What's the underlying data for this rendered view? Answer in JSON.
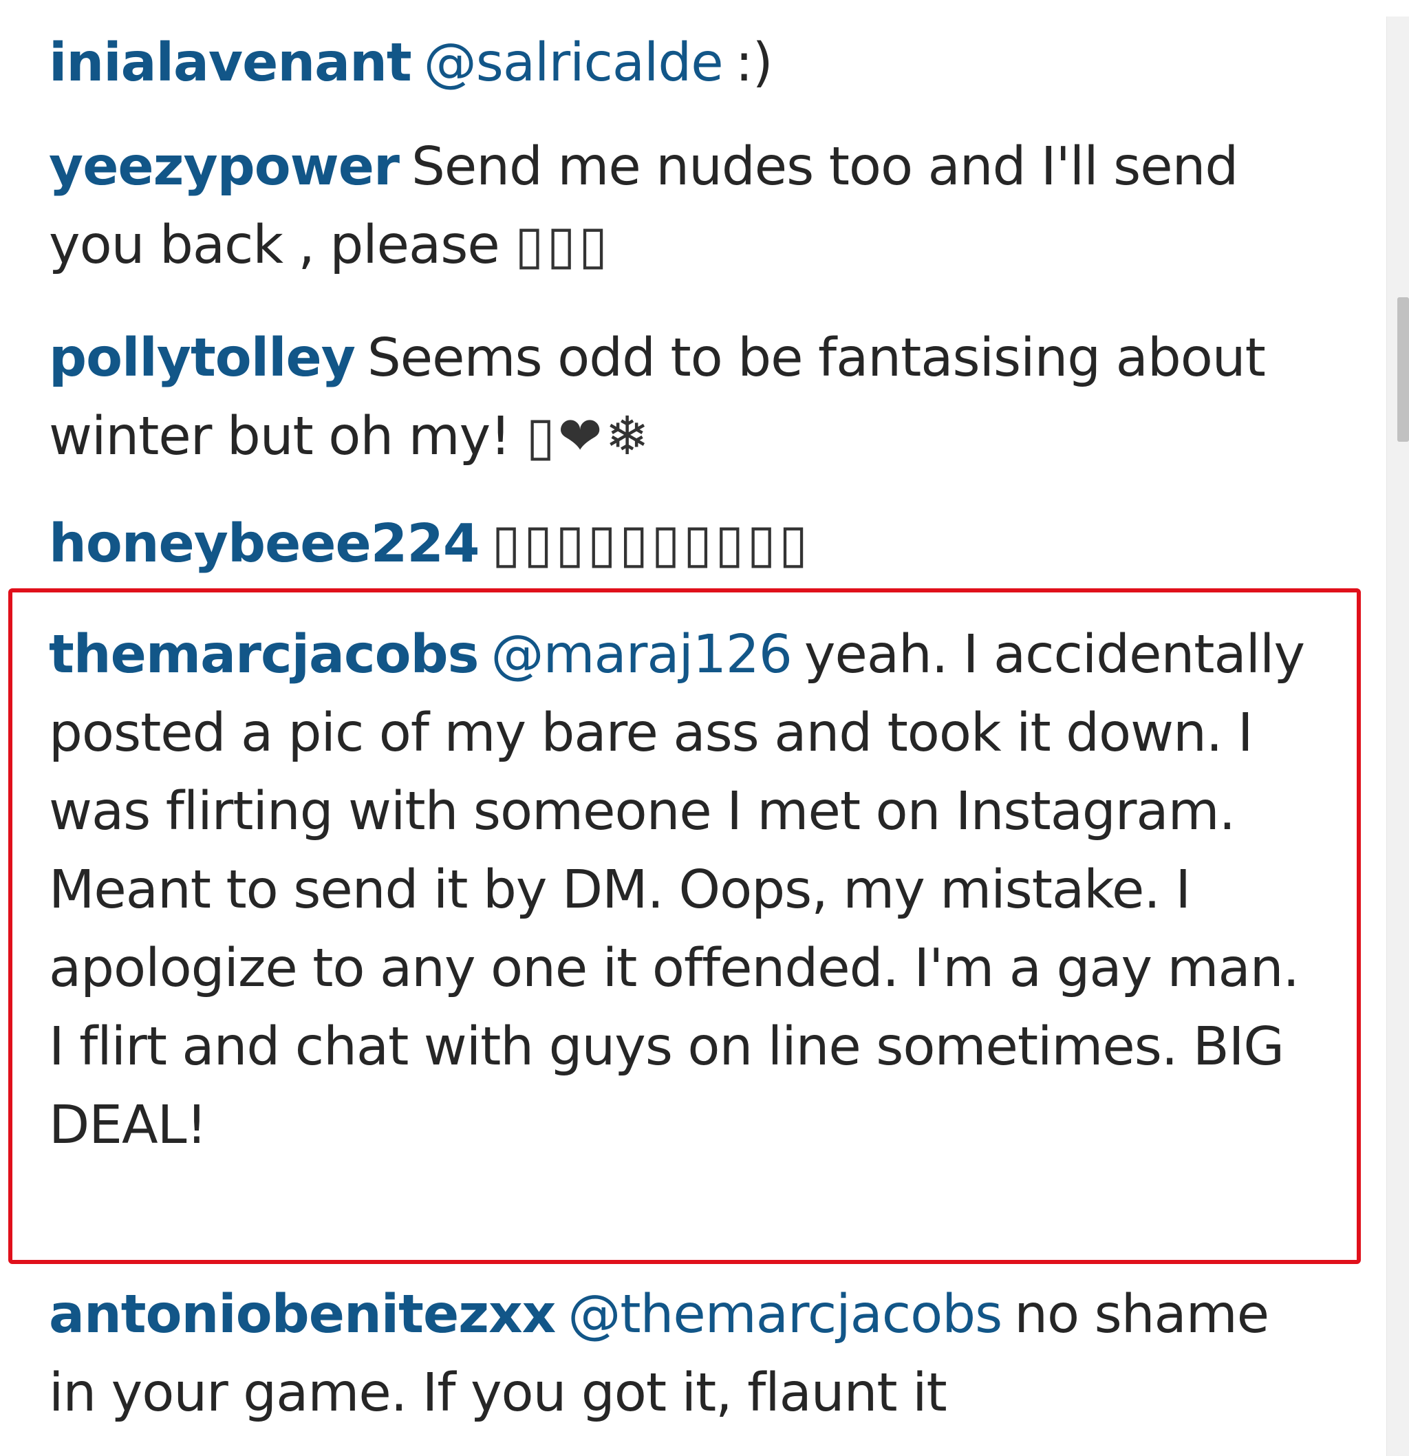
{
  "comments": [
    {
      "username": "inialavenant",
      "mention": "@salricalde",
      "text": ":)"
    },
    {
      "username": "yeezypower",
      "text": "Send me nudes too and I'll send you back , please",
      "emoji": "▯▯▯"
    },
    {
      "username": "pollytolley",
      "text": "Seems odd to be fantasising about winter but oh my!",
      "emoji": "▯❤❄"
    },
    {
      "username": "honeybeee224",
      "emoji": "▯▯▯▯▯▯▯▯▯▯"
    },
    {
      "username": "themarcjacobs",
      "mention": "@maraj126",
      "text": "yeah. I accidentally posted a pic of my bare ass and took it down. I was flirting with someone I met on Instagram. Meant to send it by DM. Oops, my mistake. I apologize to any one it offended. I'm a gay man. I flirt and chat with guys on line sometimes. BIG DEAL!"
    },
    {
      "username": "antoniobenitezxx",
      "mention": "@themarcjacobs",
      "text": "no shame in your game. If you got it, flaunt it"
    }
  ],
  "colors": {
    "username": "#125688",
    "mention": "#125688",
    "text": "#262626",
    "highlight_border": "#e0101b",
    "scrollbar_thumb": "#c1c1c1"
  }
}
